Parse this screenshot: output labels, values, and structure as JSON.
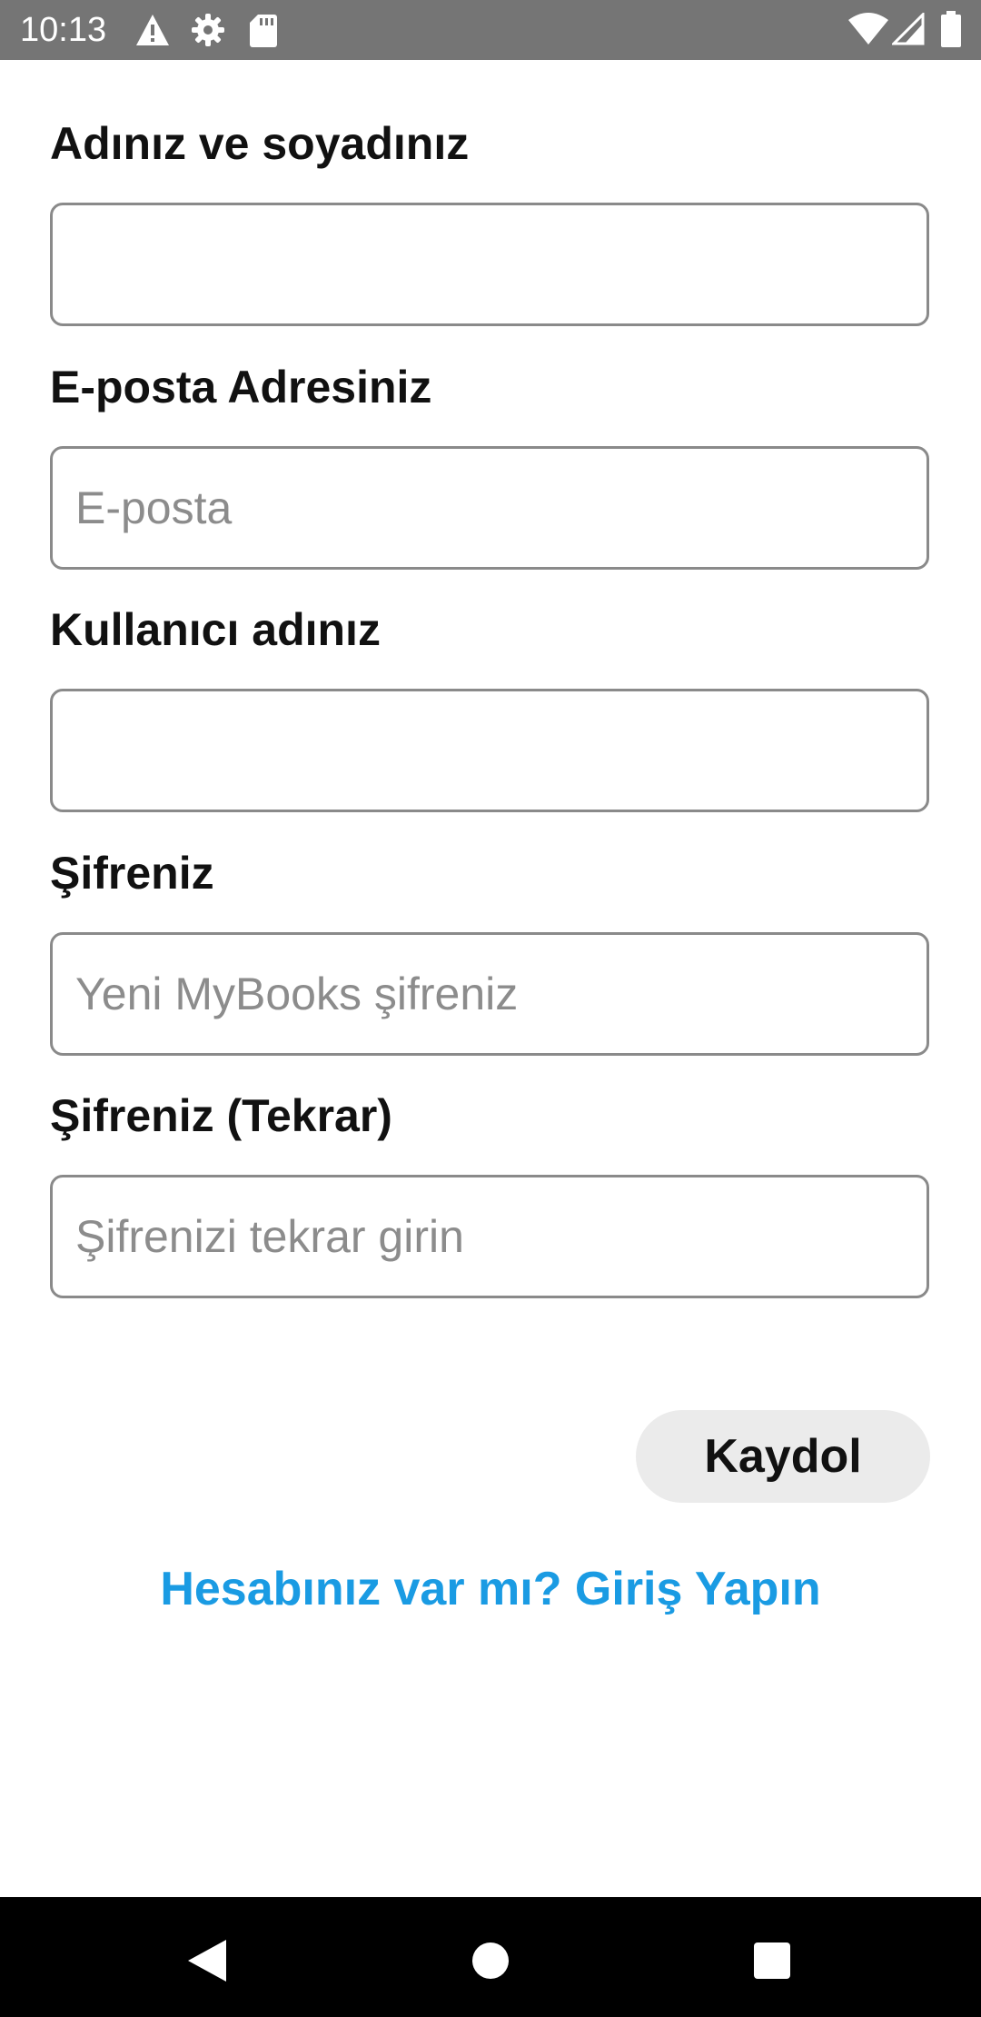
{
  "status_bar": {
    "time": "10:13",
    "left_icons": [
      "warning-icon",
      "gear-icon",
      "sd-card-icon"
    ],
    "right_icons": [
      "wifi-icon",
      "signal-icon",
      "battery-icon"
    ]
  },
  "form": {
    "fields": [
      {
        "label": "Adınız ve soyadınız",
        "value": "",
        "placeholder": ""
      },
      {
        "label": "E-posta Adresiniz",
        "value": "",
        "placeholder": "E-posta"
      },
      {
        "label": "Kullanıcı adınız",
        "value": "",
        "placeholder": ""
      },
      {
        "label": "Şifreniz",
        "value": "",
        "placeholder": "Yeni MyBooks şifreniz"
      },
      {
        "label": "Şifreniz (Tekrar)",
        "value": "",
        "placeholder": "Şifrenizi tekrar girin"
      }
    ],
    "submit_label": "Kaydol",
    "login_link": "Hesabınız var mı? Giriş Yapın"
  },
  "colors": {
    "status_bar": "#757575",
    "accent_link": "#1a9be3",
    "button_bg": "#ebebeb",
    "nav_bar": "#000000"
  },
  "nav_bar": {
    "buttons": [
      "back-icon",
      "home-icon",
      "recents-icon"
    ]
  }
}
